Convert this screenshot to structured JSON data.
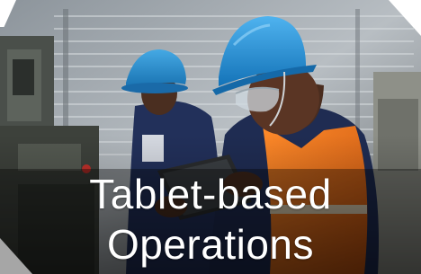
{
  "caption": {
    "line1": "Tablet-based",
    "line2": "Operations"
  },
  "colors": {
    "band": "#000000",
    "text": "#ffffff",
    "helmet": "#1e8fd6",
    "vest": "#f07a1e",
    "shirt": "#1f2c52"
  },
  "image": {
    "subject": "two workers in blue hard hats; one holds a tablet in an industrial setting"
  }
}
